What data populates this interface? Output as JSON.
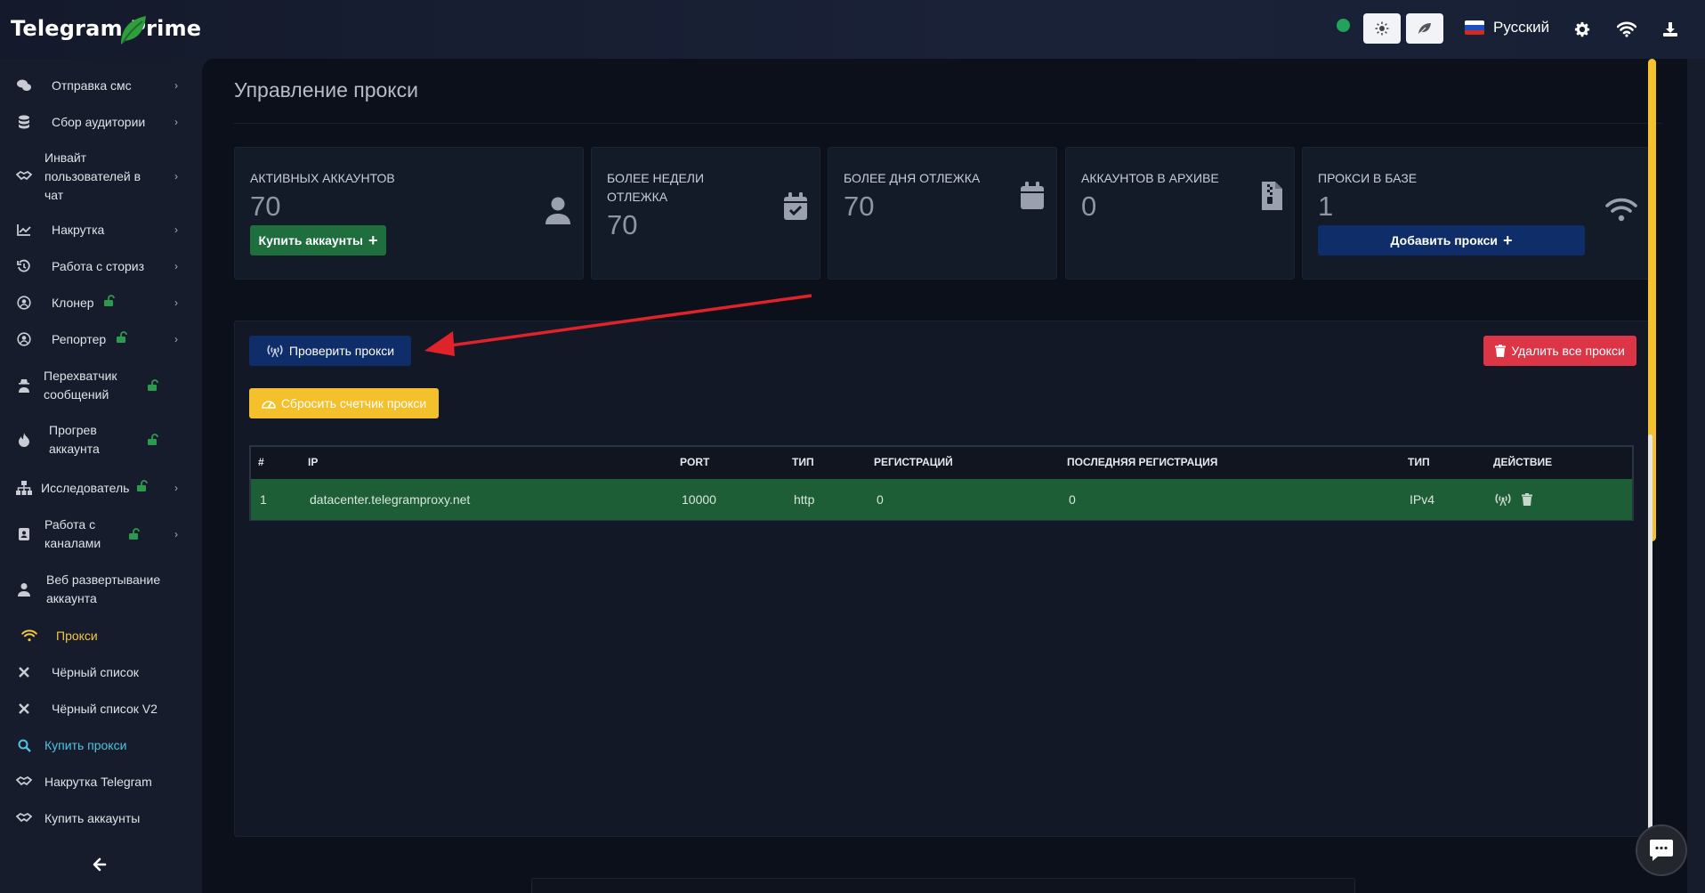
{
  "app": {
    "title": "Telegram Prime",
    "language": "Русский"
  },
  "colors": {
    "accent_yellow": "#f2c744",
    "online": "#23a35a",
    "danger": "#dc3545",
    "primary": "#0f2d69",
    "success": "#1f6e3d",
    "link": "#4fc3e0"
  },
  "sidebar": {
    "items": [
      {
        "label": "Отправка смс",
        "icon": "sms-icon",
        "submenu": true,
        "locked": false
      },
      {
        "label": "Сбор аудитории",
        "icon": "database-icon",
        "submenu": true,
        "locked": false
      },
      {
        "label": "Инвайт пользователей в чат",
        "icon": "handshake-icon",
        "submenu": true,
        "locked": false
      },
      {
        "label": "Накрутка",
        "icon": "chart-line-icon",
        "submenu": true,
        "locked": false
      },
      {
        "label": "Работа с сториз",
        "icon": "history-icon",
        "submenu": true,
        "locked": false
      },
      {
        "label": "Клонер",
        "icon": "user-circle-icon",
        "submenu": true,
        "locked": true
      },
      {
        "label": "Репортер",
        "icon": "user-circle-icon",
        "submenu": true,
        "locked": true
      },
      {
        "label": "Перехватчик сообщений",
        "icon": "user-secret-icon",
        "submenu": false,
        "locked": true
      },
      {
        "label": "Прогрев аккаунта",
        "icon": "fire-icon",
        "submenu": false,
        "locked": true
      },
      {
        "label": "Исследователь",
        "icon": "sitemap-icon",
        "submenu": true,
        "locked": true
      },
      {
        "label": "Работа с каналами",
        "icon": "id-badge-icon",
        "submenu": true,
        "locked": true
      },
      {
        "label": "Веб развертывание аккаунта",
        "icon": "user-icon",
        "submenu": false,
        "locked": false
      },
      {
        "label": "Прокси",
        "icon": "wifi-icon",
        "submenu": false,
        "locked": false,
        "active": true
      },
      {
        "label": "Чёрный список",
        "icon": "x-icon",
        "submenu": false,
        "locked": false
      },
      {
        "label": "Чёрный список V2",
        "icon": "x-icon",
        "submenu": false,
        "locked": false
      },
      {
        "label": "Купить прокси",
        "icon": "search-icon",
        "submenu": false,
        "locked": false,
        "link": true
      },
      {
        "label": "Накрутка Telegram",
        "icon": "handshake-icon",
        "submenu": false,
        "locked": false
      },
      {
        "label": "Купить аккаунты",
        "icon": "handshake-icon",
        "submenu": false,
        "locked": false
      }
    ]
  },
  "page": {
    "title": "Управление прокси"
  },
  "stats": [
    {
      "label": "АКТИВНЫХ АККАУНТОВ",
      "value": "70",
      "icon": "user-icon",
      "button": "Купить аккаунты"
    },
    {
      "label": "БОЛЕЕ НЕДЕЛИ ОТЛЕЖКА",
      "value": "70",
      "icon": "calendar-check-icon"
    },
    {
      "label": "БОЛЕЕ ДНЯ ОТЛЕЖКА",
      "value": "70",
      "icon": "calendar-icon"
    },
    {
      "label": "АККАУНТОВ В АРХИВЕ",
      "value": "0",
      "icon": "file-archive-icon"
    },
    {
      "label": "ПРОКСИ В БАЗЕ",
      "value": "1",
      "icon": "wifi-icon",
      "button": "Добавить прокси"
    }
  ],
  "actions": {
    "check": "Проверить прокси",
    "delete_all": "Удалить все прокси",
    "reset": "Сбросить счетчик прокси"
  },
  "table": {
    "columns": [
      "#",
      "IP",
      "PORT",
      "ТИП",
      "РЕГИСТРАЦИЙ",
      "ПОСЛЕДНЯЯ РЕГИСТРАЦИЯ",
      "ТИП",
      "ДЕЙСТВИЕ"
    ],
    "rows": [
      [
        "1",
        "datacenter.telegramproxy.net",
        "10000",
        "http",
        "0",
        "0",
        "IPv4"
      ]
    ]
  }
}
